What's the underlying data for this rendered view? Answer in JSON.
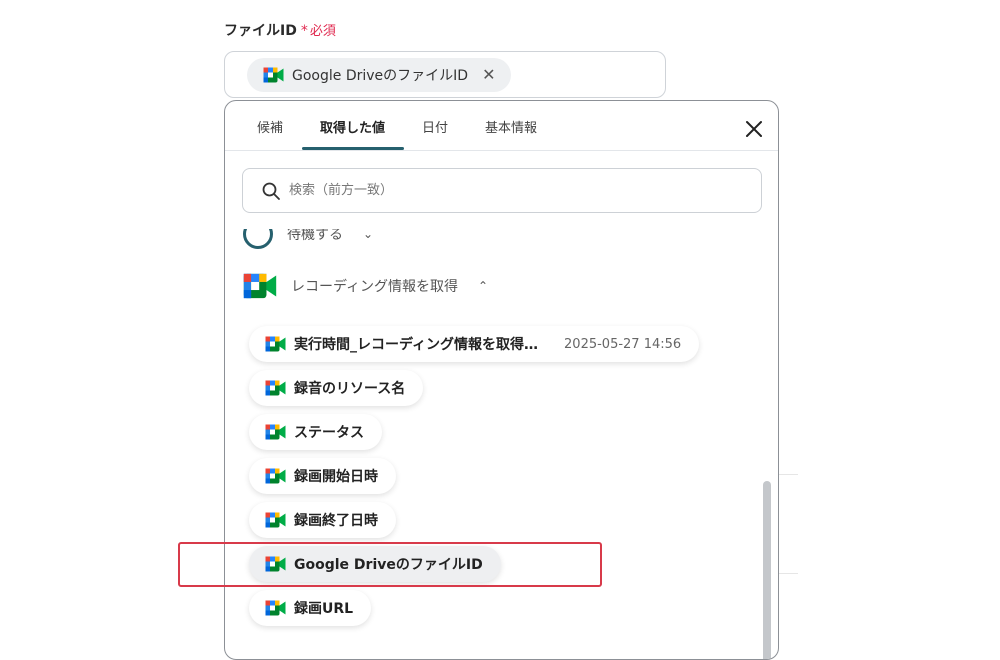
{
  "field": {
    "label": "ファイルID",
    "required_star": "*",
    "required_text": "必須",
    "chip_label": "Google DriveのファイルID",
    "chip_remove": "✕"
  },
  "tabs": [
    {
      "label": "候補",
      "active": false
    },
    {
      "label": "取得した値",
      "active": true
    },
    {
      "label": "日付",
      "active": false
    },
    {
      "label": "基本情報",
      "active": false
    }
  ],
  "search": {
    "placeholder": "検索（前方一致）"
  },
  "groups": {
    "wait": {
      "label": "待機する",
      "chevron": "⌄"
    },
    "recording": {
      "label": "レコーディング情報を取得",
      "chevron": "⌃"
    }
  },
  "items": [
    {
      "label": "実行時間_レコーディング情報を取得…",
      "date": "2025-05-27 14:56"
    },
    {
      "label": "録音のリソース名",
      "date": ""
    },
    {
      "label": "ステータス",
      "date": ""
    },
    {
      "label": "録画開始日時",
      "date": ""
    },
    {
      "label": "録画終了日時",
      "date": ""
    },
    {
      "label": "Google DriveのファイルID",
      "date": "",
      "selected": true
    },
    {
      "label": "録画URL",
      "date": ""
    }
  ],
  "colors": {
    "accent": "#26606e",
    "required": "#e0294f",
    "highlight": "#d83a4a",
    "meet_green": "#00832d",
    "meet_blue": "#2684fc",
    "meet_yellow": "#ffba00",
    "meet_red": "#ea4335"
  },
  "icons": {
    "meet": "google-meet-icon",
    "search": "search-icon",
    "close": "close-icon",
    "wait": "wait-clock-icon"
  }
}
